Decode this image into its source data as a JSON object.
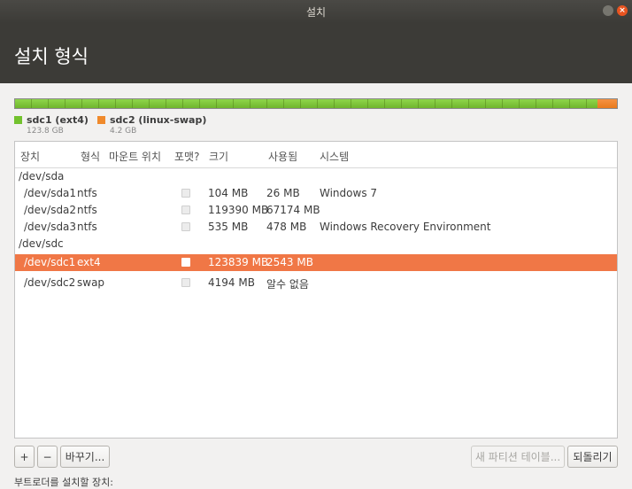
{
  "window": {
    "title": "설치",
    "minimize_glyph": "–",
    "close_glyph": "×"
  },
  "header": {
    "heading": "설치 형식"
  },
  "partition_bar": {
    "segments": [
      {
        "name": "sdc1 (ext4)",
        "size": "123.8 GB",
        "color": "#73c22e",
        "fraction": 0.967
      },
      {
        "name": "sdc2 (linux-swap)",
        "size": "4.2 GB",
        "color": "#f08a2c",
        "fraction": 0.033
      }
    ]
  },
  "table": {
    "columns": {
      "device": "장치",
      "type": "형식",
      "mount": "마운트 위치",
      "format": "포맷?",
      "size": "크기",
      "used": "사용됨",
      "system": "시스템"
    },
    "rows": [
      {
        "device": "/dev/sda",
        "type": "",
        "mount": "",
        "format": null,
        "size": "",
        "used": "",
        "system": "",
        "group": true,
        "selected": false
      },
      {
        "device": "/dev/sda1",
        "type": "ntfs",
        "mount": "",
        "format": false,
        "size": "104 MB",
        "used": "26 MB",
        "system": "Windows 7",
        "group": false,
        "selected": false
      },
      {
        "device": "/dev/sda2",
        "type": "ntfs",
        "mount": "",
        "format": false,
        "size": "119390 MB",
        "used": "67174 MB",
        "system": "",
        "group": false,
        "selected": false
      },
      {
        "device": "/dev/sda3",
        "type": "ntfs",
        "mount": "",
        "format": false,
        "size": "535 MB",
        "used": "478 MB",
        "system": "Windows Recovery Environment",
        "group": false,
        "selected": false
      },
      {
        "device": "/dev/sdc",
        "type": "",
        "mount": "",
        "format": null,
        "size": "",
        "used": "",
        "system": "",
        "group": true,
        "selected": false
      },
      {
        "device": "/dev/sdc1",
        "type": "ext4",
        "mount": "",
        "format": false,
        "size": "123839 MB",
        "used": "2543 MB",
        "system": "",
        "group": false,
        "selected": true
      },
      {
        "device": "/dev/sdc2",
        "type": "swap",
        "mount": "",
        "format": false,
        "size": "4194 MB",
        "used": "알수 없음",
        "system": "",
        "group": false,
        "selected": false
      }
    ]
  },
  "buttons": {
    "add": "+",
    "remove": "−",
    "change": "바꾸기...",
    "new_partition_table": "새 파티션 테이블...",
    "revert": "되돌리기"
  },
  "bottom_label": "부트로더를 설치할 장치:",
  "colors": {
    "accent": "#f07746",
    "header_bg": "#3c3b37"
  }
}
